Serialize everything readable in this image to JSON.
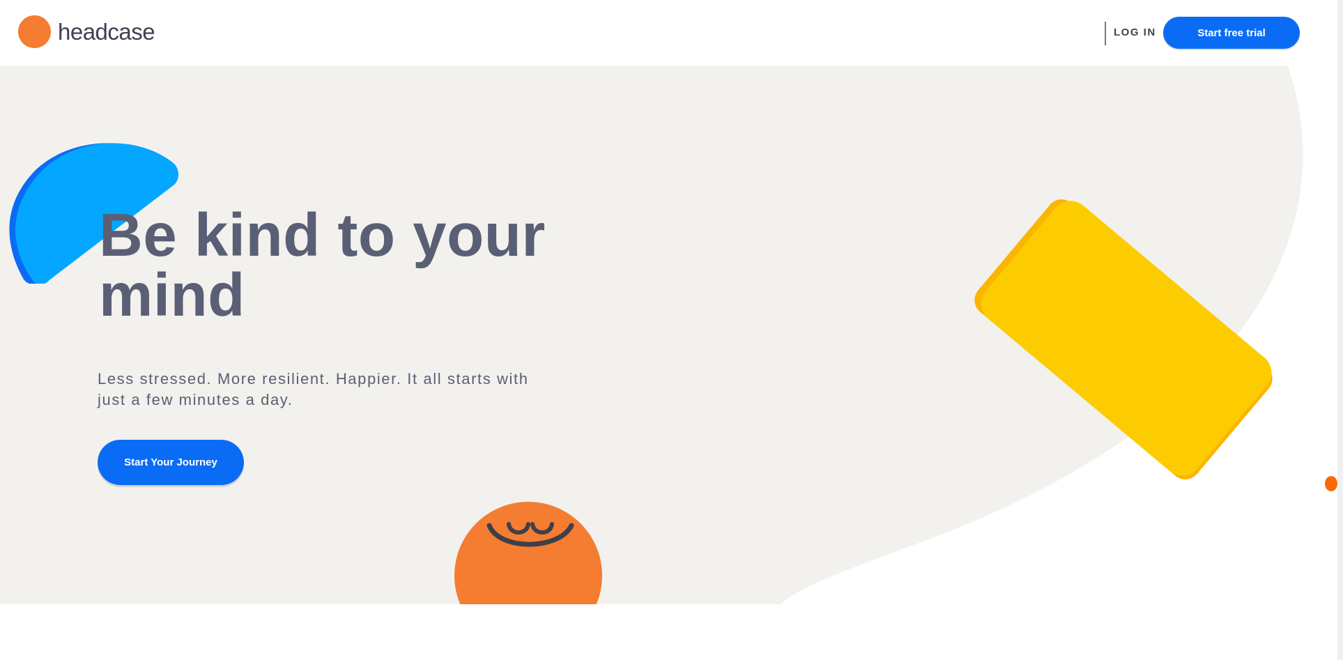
{
  "brand": {
    "name": "headcase",
    "logo_color": "#f47d31"
  },
  "nav": {
    "login_label": "LOG IN",
    "trial_label": "Start free trial"
  },
  "hero": {
    "headline": "Be kind to your mind",
    "subhead": "Less stressed. More resilient. Happier. It all starts with just a few minutes a day.",
    "cta_label": "Start Your Journey"
  },
  "colors": {
    "primary_blue": "#0a6cf5",
    "hero_background": "#f3f1ed",
    "text_slate": "#5a5f75",
    "blue_shape": "#05a6ff",
    "yellow_shape": "#fdcc00",
    "orange_character": "#f47d31"
  },
  "icons": {
    "logo": "orange-circle",
    "character": "smiling-orange-face",
    "blue": "half-circle-shape",
    "yellow": "rounded-rectangle-shape"
  }
}
